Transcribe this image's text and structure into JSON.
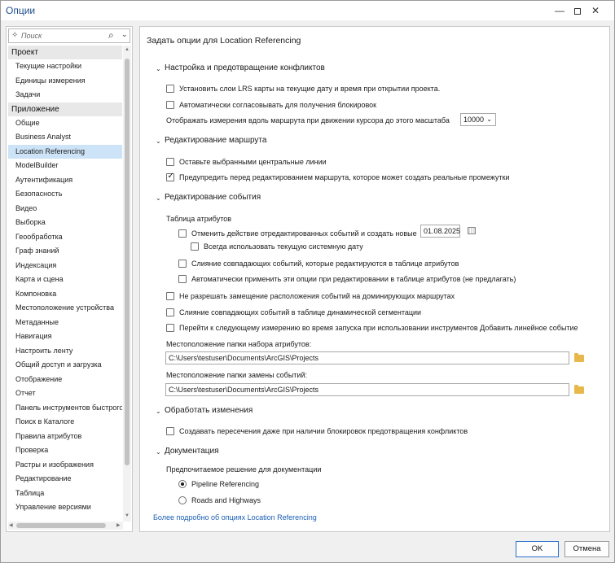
{
  "window": {
    "title": "Опции"
  },
  "search": {
    "placeholder": "Поиск"
  },
  "nav": {
    "project_header": "Проект",
    "project_items": [
      "Текущие настройки",
      "Единицы измерения",
      "Задачи"
    ],
    "app_header": "Приложение",
    "app_items": [
      "Общие",
      "Business Analyst",
      "Location Referencing",
      "ModelBuilder",
      "Аутентификация",
      "Безопасность",
      "Видео",
      "Выборка",
      "Геообработка",
      "Граф знаний",
      "Индексация",
      "Карта и сцена",
      "Компоновка",
      "Местоположение устройства",
      "Метаданные",
      "Навигация",
      "Настроить ленту",
      "Общий доступ и загрузка",
      "Отображение",
      "Отчет",
      "Панель инструментов быстрого доступа",
      "Поиск в Каталоге",
      "Правила атрибутов",
      "Проверка",
      "Растры и изображения",
      "Редактирование",
      "Таблица",
      "Управление версиями"
    ],
    "selected": "Location Referencing"
  },
  "page": {
    "title": "Задать опции для Location Referencing",
    "sections": {
      "conflicts": {
        "header": "Настройка и предотвращение конфликтов",
        "opt_set_layers": {
          "label": "Установить слои LRS карты на текущие дату и время при открытии проекта.",
          "checked": false
        },
        "opt_auto_reconcile": {
          "label": "Автоматически согласовывать для получения блокировок",
          "checked": false
        },
        "scale_label": "Отображать измерения вдоль маршрута при движении курсора до этого масштаба",
        "scale_value": "10000"
      },
      "route_editing": {
        "header": "Редактирование маршрута",
        "opt_keep_centerlines": {
          "label": "Оставьте выбранными центральные линии",
          "checked": false
        },
        "opt_warn_gaps": {
          "label": "Предупредить перед редактированием маршрута, которое может создать реальные промежутки",
          "checked": true
        }
      },
      "event_editing": {
        "header": "Редактирование события",
        "attr_table_label": "Таблица атрибутов",
        "opt_retire_create": {
          "label": "Отменить действие отредактированных событий и создать новые",
          "checked": false
        },
        "date_value": "01.08.2025",
        "opt_system_date": {
          "label": "Всегда использовать текущую системную дату",
          "checked": false
        },
        "opt_merge_coincident_table": {
          "label": "Слияние совпадающих событий, которые редактируются в таблице атрибутов",
          "checked": false
        },
        "opt_auto_apply": {
          "label": "Автоматически применить эти опции при редактировании в таблице атрибутов (не предлагать)",
          "checked": false
        },
        "opt_no_replace_dominant": {
          "label": "Не разрешать замещение расположения событий на доминирующих маршрутах",
          "checked": false
        },
        "opt_merge_dynseg": {
          "label": "Слияние совпадающих событий в таблице динамической сегментации",
          "checked": false
        },
        "opt_next_measure": {
          "label": "Перейти к следующему измерению во время запуска при использовании инструментов Добавить линейное событие",
          "checked": false
        },
        "attr_folder_label": "Местоположение папки набора атрибутов:",
        "attr_folder_path": "C:\\Users\\testuser\\Documents\\ArcGIS\\Projects",
        "replace_folder_label": "Местоположение папки замены событий:",
        "replace_folder_path": "C:\\Users\\testuser\\Documents\\ArcGIS\\Projects"
      },
      "process_changes": {
        "header": "Обработать изменения",
        "opt_create_intersections": {
          "label": "Создавать пересечения даже при наличии блокировок предотвращения конфликтов",
          "checked": false
        }
      },
      "documentation": {
        "header": "Документация",
        "preferred_label": "Предпочитаемое решение для документации",
        "radio_pipeline": {
          "label": "Pipeline Referencing",
          "checked": true
        },
        "radio_roads": {
          "label": "Roads and Highways",
          "checked": false
        }
      }
    },
    "more_link": "Более подробно об опциях Location Referencing"
  },
  "footer": {
    "ok_label": "OK",
    "cancel_label": "Отмена"
  },
  "colors": {
    "accent": "#1a5fb4",
    "selected_bg": "#cde3f7",
    "ok_border": "#2b6fc9"
  }
}
